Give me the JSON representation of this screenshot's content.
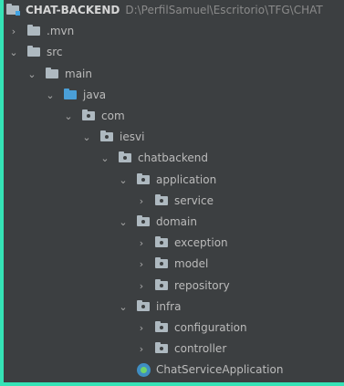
{
  "tree": [
    {
      "label": "CHAT-BACKEND",
      "path": "D:\\PerfilSamuel\\Escritorio\\TFG\\CHAT",
      "depth": 0,
      "arrow": "",
      "icon": "module-folder-icon",
      "root": true
    },
    {
      "label": ".mvn",
      "depth": 0,
      "arrow": "›",
      "icon": "folder-icon"
    },
    {
      "label": "src",
      "depth": 0,
      "arrow": "⌄",
      "icon": "folder-icon"
    },
    {
      "label": "main",
      "depth": 1,
      "arrow": "⌄",
      "icon": "folder-icon"
    },
    {
      "label": "java",
      "depth": 2,
      "arrow": "⌄",
      "icon": "source-folder-icon"
    },
    {
      "label": "com",
      "depth": 3,
      "arrow": "⌄",
      "icon": "package-icon"
    },
    {
      "label": "iesvi",
      "depth": 4,
      "arrow": "⌄",
      "icon": "package-icon"
    },
    {
      "label": "chatbackend",
      "depth": 5,
      "arrow": "⌄",
      "icon": "package-icon"
    },
    {
      "label": "application",
      "depth": 6,
      "arrow": "⌄",
      "icon": "package-icon"
    },
    {
      "label": "service",
      "depth": 7,
      "arrow": "›",
      "icon": "package-icon"
    },
    {
      "label": "domain",
      "depth": 6,
      "arrow": "⌄",
      "icon": "package-icon"
    },
    {
      "label": "exception",
      "depth": 7,
      "arrow": "›",
      "icon": "package-icon"
    },
    {
      "label": "model",
      "depth": 7,
      "arrow": "›",
      "icon": "package-icon"
    },
    {
      "label": "repository",
      "depth": 7,
      "arrow": "›",
      "icon": "package-icon"
    },
    {
      "label": "infra",
      "depth": 6,
      "arrow": "⌄",
      "icon": "package-icon"
    },
    {
      "label": "configuration",
      "depth": 7,
      "arrow": "›",
      "icon": "package-icon"
    },
    {
      "label": "controller",
      "depth": 7,
      "arrow": "›",
      "icon": "package-icon"
    },
    {
      "label": "ChatServiceApplication",
      "depth": 6,
      "arrow": "",
      "icon": "spring-boot-class-icon"
    }
  ],
  "colors": {
    "background": "#35e3b6",
    "panel": "#3c3f41",
    "text": "#bbbbbb",
    "path_text": "#8a8a8a",
    "source_folder": "#4a9fd8"
  }
}
